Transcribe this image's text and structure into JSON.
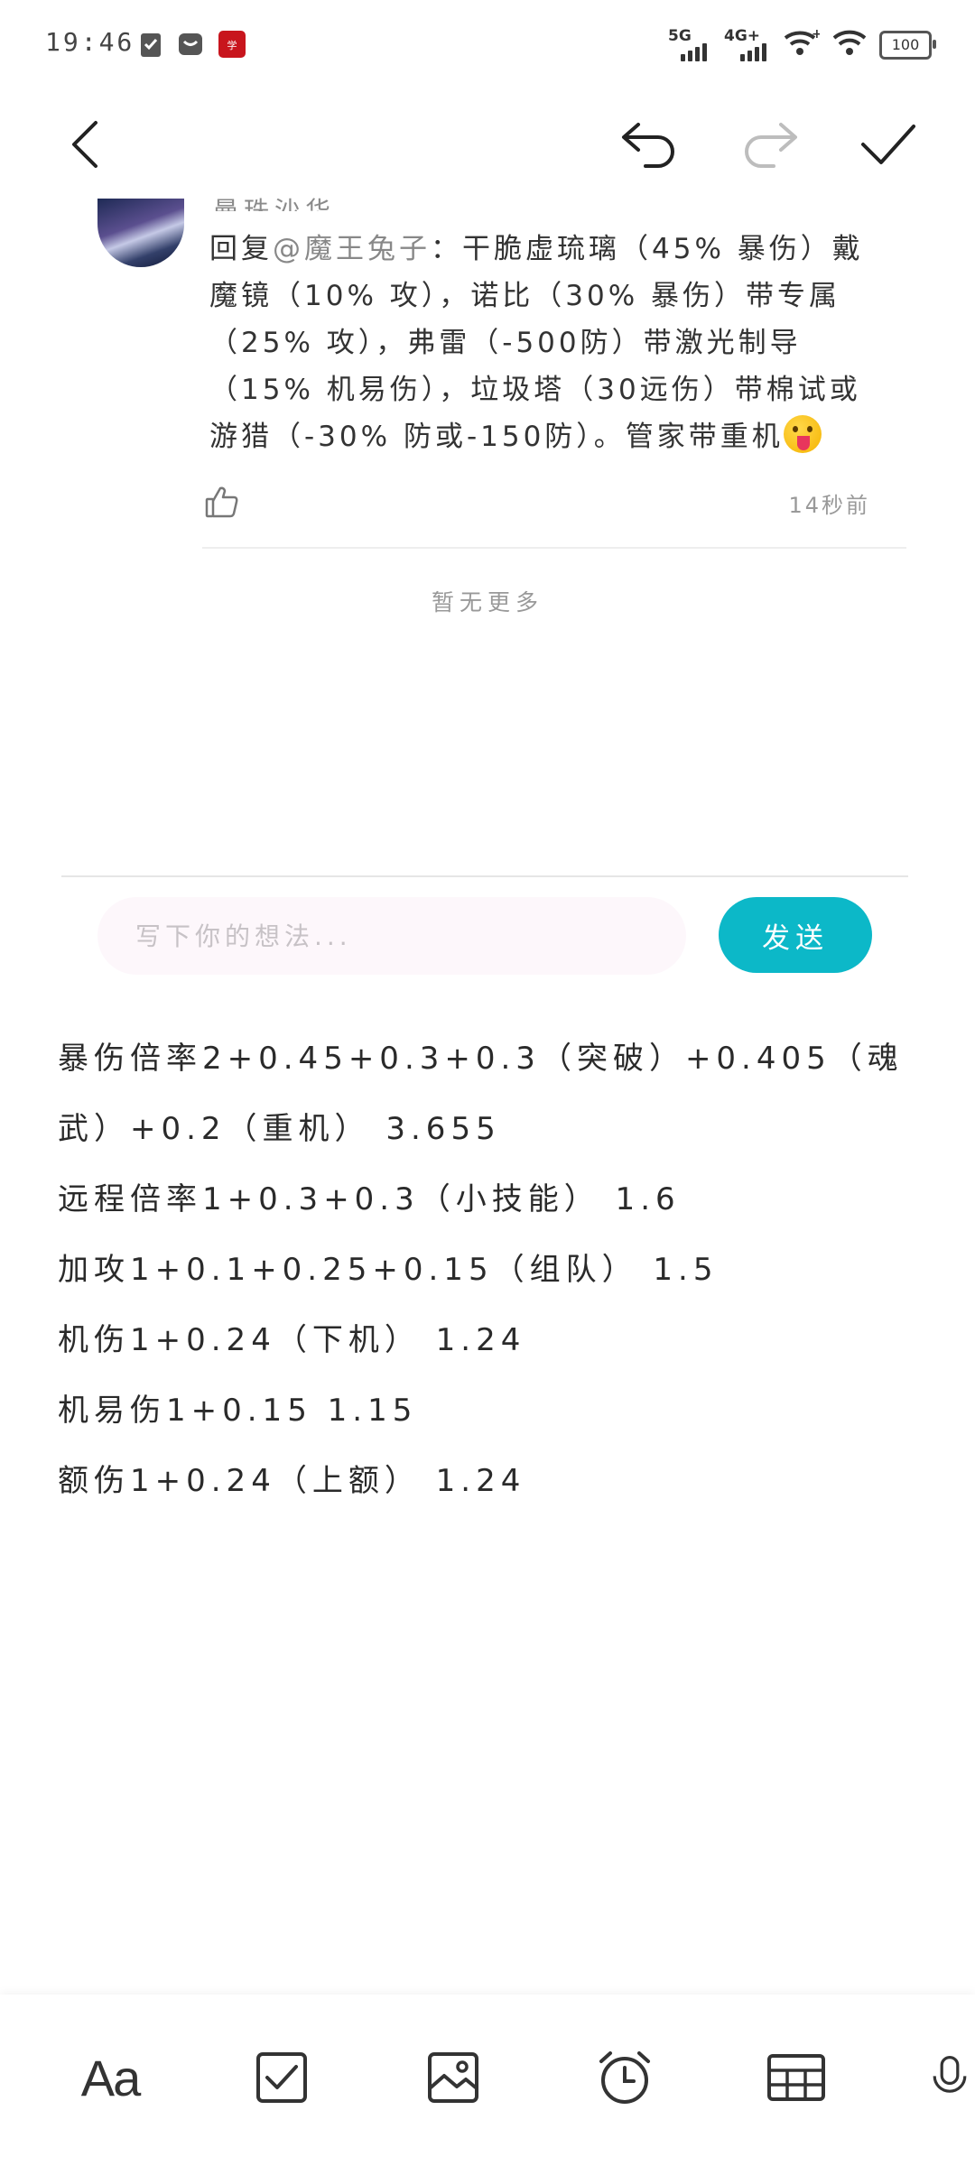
{
  "status_bar": {
    "time": "19:46",
    "signal1_label": "5G",
    "signal2_label": "4G+",
    "battery": "100"
  },
  "comment": {
    "author_cut": "曼珠沙华",
    "reply_prefix": "回复",
    "mention": "@魔王兔子",
    "text": "：干脆虚琉璃（45% 暴伤）戴魔镜（10% 攻），诺比（30% 暴伤）带专属（25% 攻），弗雷（-500防）带激光制导（15% 机易伤），垃圾塔（30远伤）带棉试或游猎（-30% 防或-150防）。管家带重机",
    "time": "14秒前"
  },
  "no_more": "暂无更多",
  "reply": {
    "placeholder": "写下你的想法...",
    "send_label": "发送"
  },
  "note_lines": [
    "暴伤倍率2+0.45+0.3+0.3（突破）+0.405（魂武）+0.2（重机） 3.655",
    "远程倍率1+0.3+0.3（小技能） 1.6",
    "加攻1+0.1+0.25+0.15（组队） 1.5",
    "机伤1+0.24（下机） 1.24",
    "机易伤1+0.15 1.15",
    "额伤1+0.24（上额） 1.24"
  ],
  "bottom_toolbar": {
    "font_label": "Aa"
  },
  "colors": {
    "accent": "#0cb8c8",
    "input_bg": "#fdf7fb"
  }
}
